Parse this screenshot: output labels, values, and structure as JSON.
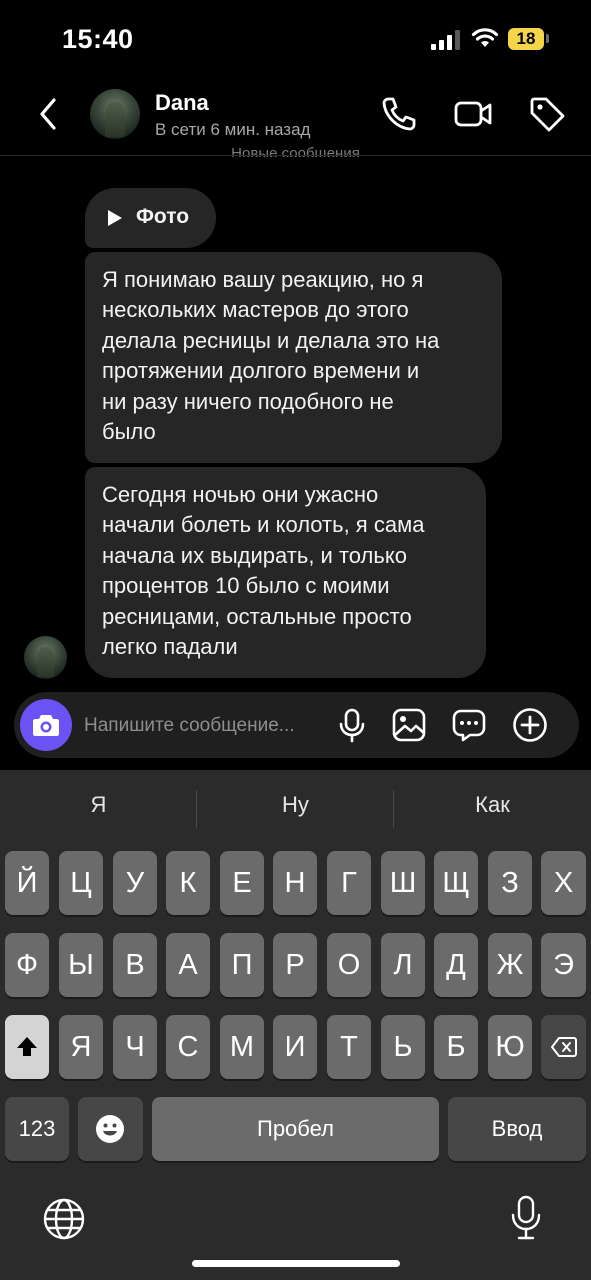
{
  "status_bar": {
    "time": "15:40",
    "battery": "18"
  },
  "header": {
    "contact_name": "Dana",
    "contact_status": "В сети 6 мин. назад",
    "icons": [
      "back-icon",
      "phone-icon",
      "video-camera-icon",
      "tag-icon"
    ]
  },
  "chat": {
    "new_messages_divider": "Новые сообщения",
    "photo_message": "Фото",
    "messages": [
      {
        "text": "Я понимаю вашу реакцию, но я\nнескольких мастеров до этого\nделала ресницы и делала это на\nпротяжении долгого времени и\nни разу ничего подобного не\nбыло"
      },
      {
        "text": "Сегодня ночью они ужасно\nначали болеть и колоть, я сама\nначала их выдирать, и только\nпроцентов 10 было с моими\nресницами, остальные просто\nлегко падали"
      }
    ]
  },
  "composer": {
    "placeholder": "Напишите сообщение...",
    "value": "",
    "accent_color": "#6a52f5"
  },
  "keyboard": {
    "suggestions": [
      "Я",
      "Ну",
      "Как"
    ],
    "row1": [
      "Й",
      "Ц",
      "У",
      "К",
      "Е",
      "Н",
      "Г",
      "Ш",
      "Щ",
      "З",
      "Х"
    ],
    "row2": [
      "Ф",
      "Ы",
      "В",
      "А",
      "П",
      "Р",
      "О",
      "Л",
      "Д",
      "Ж",
      "Э"
    ],
    "row3": [
      "Я",
      "Ч",
      "С",
      "М",
      "И",
      "Т",
      "Ь",
      "Б",
      "Ю"
    ],
    "numbers_label": "123",
    "space_label": "Пробел",
    "return_label": "Ввод"
  }
}
